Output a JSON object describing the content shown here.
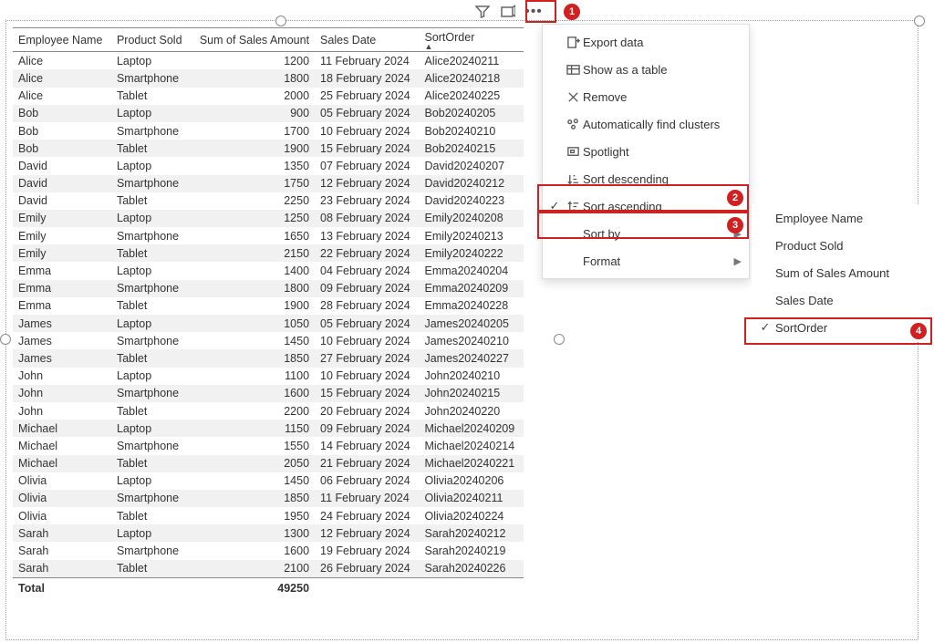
{
  "columns": [
    "Employee Name",
    "Product Sold",
    "Sum of Sales Amount",
    "Sales Date",
    "SortOrder"
  ],
  "rows": [
    [
      "Alice",
      "Laptop",
      "1200",
      "11 February 2024",
      "Alice20240211"
    ],
    [
      "Alice",
      "Smartphone",
      "1800",
      "18 February 2024",
      "Alice20240218"
    ],
    [
      "Alice",
      "Tablet",
      "2000",
      "25 February 2024",
      "Alice20240225"
    ],
    [
      "Bob",
      "Laptop",
      "900",
      "05 February 2024",
      "Bob20240205"
    ],
    [
      "Bob",
      "Smartphone",
      "1700",
      "10 February 2024",
      "Bob20240210"
    ],
    [
      "Bob",
      "Tablet",
      "1900",
      "15 February 2024",
      "Bob20240215"
    ],
    [
      "David",
      "Laptop",
      "1350",
      "07 February 2024",
      "David20240207"
    ],
    [
      "David",
      "Smartphone",
      "1750",
      "12 February 2024",
      "David20240212"
    ],
    [
      "David",
      "Tablet",
      "2250",
      "23 February 2024",
      "David20240223"
    ],
    [
      "Emily",
      "Laptop",
      "1250",
      "08 February 2024",
      "Emily20240208"
    ],
    [
      "Emily",
      "Smartphone",
      "1650",
      "13 February 2024",
      "Emily20240213"
    ],
    [
      "Emily",
      "Tablet",
      "2150",
      "22 February 2024",
      "Emily20240222"
    ],
    [
      "Emma",
      "Laptop",
      "1400",
      "04 February 2024",
      "Emma20240204"
    ],
    [
      "Emma",
      "Smartphone",
      "1800",
      "09 February 2024",
      "Emma20240209"
    ],
    [
      "Emma",
      "Tablet",
      "1900",
      "28 February 2024",
      "Emma20240228"
    ],
    [
      "James",
      "Laptop",
      "1050",
      "05 February 2024",
      "James20240205"
    ],
    [
      "James",
      "Smartphone",
      "1450",
      "10 February 2024",
      "James20240210"
    ],
    [
      "James",
      "Tablet",
      "1850",
      "27 February 2024",
      "James20240227"
    ],
    [
      "John",
      "Laptop",
      "1100",
      "10 February 2024",
      "John20240210"
    ],
    [
      "John",
      "Smartphone",
      "1600",
      "15 February 2024",
      "John20240215"
    ],
    [
      "John",
      "Tablet",
      "2200",
      "20 February 2024",
      "John20240220"
    ],
    [
      "Michael",
      "Laptop",
      "1150",
      "09 February 2024",
      "Michael20240209"
    ],
    [
      "Michael",
      "Smartphone",
      "1550",
      "14 February 2024",
      "Michael20240214"
    ],
    [
      "Michael",
      "Tablet",
      "2050",
      "21 February 2024",
      "Michael20240221"
    ],
    [
      "Olivia",
      "Laptop",
      "1450",
      "06 February 2024",
      "Olivia20240206"
    ],
    [
      "Olivia",
      "Smartphone",
      "1850",
      "11 February 2024",
      "Olivia20240211"
    ],
    [
      "Olivia",
      "Tablet",
      "1950",
      "24 February 2024",
      "Olivia20240224"
    ],
    [
      "Sarah",
      "Laptop",
      "1300",
      "12 February 2024",
      "Sarah20240212"
    ],
    [
      "Sarah",
      "Smartphone",
      "1600",
      "19 February 2024",
      "Sarah20240219"
    ],
    [
      "Sarah",
      "Tablet",
      "2100",
      "26 February 2024",
      "Sarah20240226"
    ]
  ],
  "total_label": "Total",
  "total_value": "49250",
  "menu": {
    "export": "Export data",
    "show_table": "Show as a table",
    "remove": "Remove",
    "clusters": "Automatically find clusters",
    "spotlight": "Spotlight",
    "sort_desc": "Sort descending",
    "sort_asc": "Sort ascending",
    "sort_by": "Sort by",
    "format": "Format"
  },
  "submenu": {
    "employee": "Employee Name",
    "product": "Product Sold",
    "amount": "Sum of Sales Amount",
    "date": "Sales Date",
    "sortorder": "SortOrder"
  },
  "badges": {
    "b1": "1",
    "b2": "2",
    "b3": "3",
    "b4": "4"
  }
}
